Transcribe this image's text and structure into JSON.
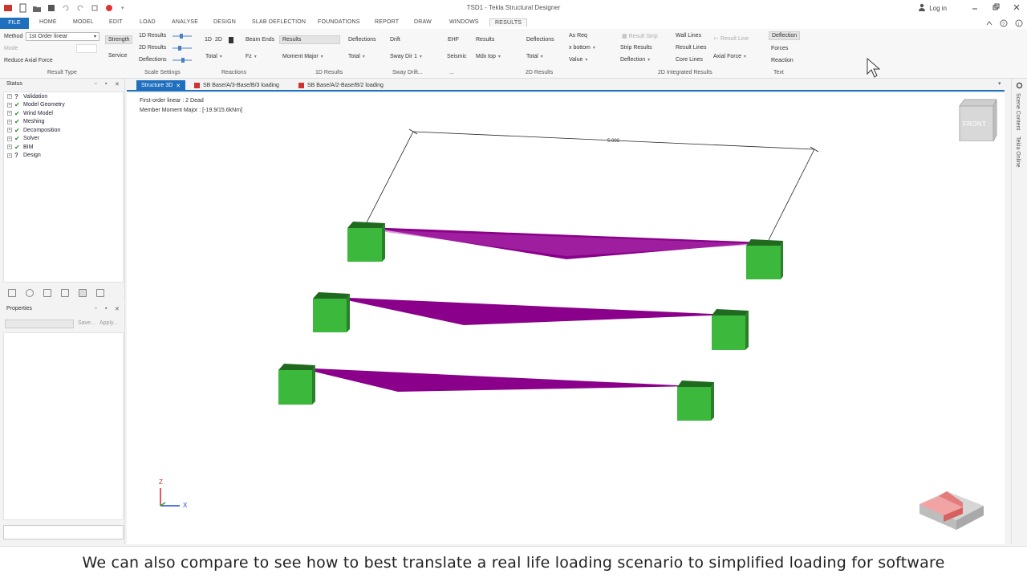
{
  "window": {
    "title": "TSD1 - Tekla Structural Designer",
    "login_label": "Log in"
  },
  "tabs": [
    "FILE",
    "HOME",
    "MODEL",
    "EDIT",
    "LOAD",
    "ANALYSE",
    "DESIGN",
    "SLAB DEFLECTION",
    "FOUNDATIONS",
    "REPORT",
    "DRAW",
    "WINDOWS",
    "RESULTS"
  ],
  "active_tab": "RESULTS",
  "ribbon": {
    "method_label": "Method",
    "method_value": "1st Order linear",
    "mode_label": "Mode",
    "strength": "Strength",
    "service": "Service",
    "reduce_axial": "Reduce Axial Force",
    "results_1d": "1D Results",
    "results_2d": "2D Results",
    "deflections": "Deflections",
    "btn_1d": "1D",
    "btn_2d": "2D",
    "total": "Total",
    "beam_ends": "Beam Ends",
    "fz": "Fz",
    "results": "Results",
    "moment_major": "Moment Major",
    "deflections2": "Deflections",
    "total2": "Total",
    "drift": "Drift",
    "sway_dir": "Sway Dir 1",
    "ehf": "EHF",
    "seismic": "Seismic",
    "results3": "Results",
    "mdx_top": "Mdx top",
    "deflections3": "Deflections",
    "total3": "Total",
    "as_req": "As Req",
    "x_bottom": "x bottom",
    "value": "Value",
    "result_strip": "Result Strip",
    "strip_results": "Strip Results",
    "deflection": "Deflection",
    "wall_lines": "Wall Lines",
    "result_lines": "Result Lines",
    "core_lines": "Core Lines",
    "result_line": "Result Line",
    "axial_force": "Axial Force",
    "deflection2": "Deflection",
    "forces": "Forces",
    "reaction": "Reaction"
  },
  "groups": {
    "result_type": "Result Type",
    "scale_settings": "Scale Settings",
    "reactions": "Reactions",
    "results_1d": "1D Results",
    "sway_drift": "Sway Drift...",
    "dots": "...",
    "results_2d": "2D Results",
    "integrated_2d": "2D Integrated Results",
    "text": "Text"
  },
  "status_panel": {
    "title": "Status",
    "items": [
      "Validation",
      "Model Geometry",
      "Wind Model",
      "Meshing",
      "Decomposition",
      "Solver",
      "BIM",
      "Design"
    ]
  },
  "properties_panel": {
    "title": "Properties",
    "save": "Save...",
    "apply": "Apply..."
  },
  "doc_tabs": [
    "Structure 3D",
    "SB Base/A/3-Base/B/3 loading",
    "SB Base/A/2-Base/B/2 loading"
  ],
  "viewport": {
    "line1": "First-order linear : 2 Dead",
    "line2": "Member Moment Major : [-19.9/15.6kNm]",
    "dimension": "5.000",
    "viewcube_label": "FRONT",
    "axis_z": "Z",
    "axis_x": "X"
  },
  "side_strip": [
    "Scene Content",
    "Tekla Online"
  ],
  "caption": "We can also compare to see how to best translate a real life loading scenario to simplified loading for software",
  "colors": {
    "accent": "#1f6fbf",
    "column": "#3cb83c",
    "diagram": "#8a008a"
  }
}
